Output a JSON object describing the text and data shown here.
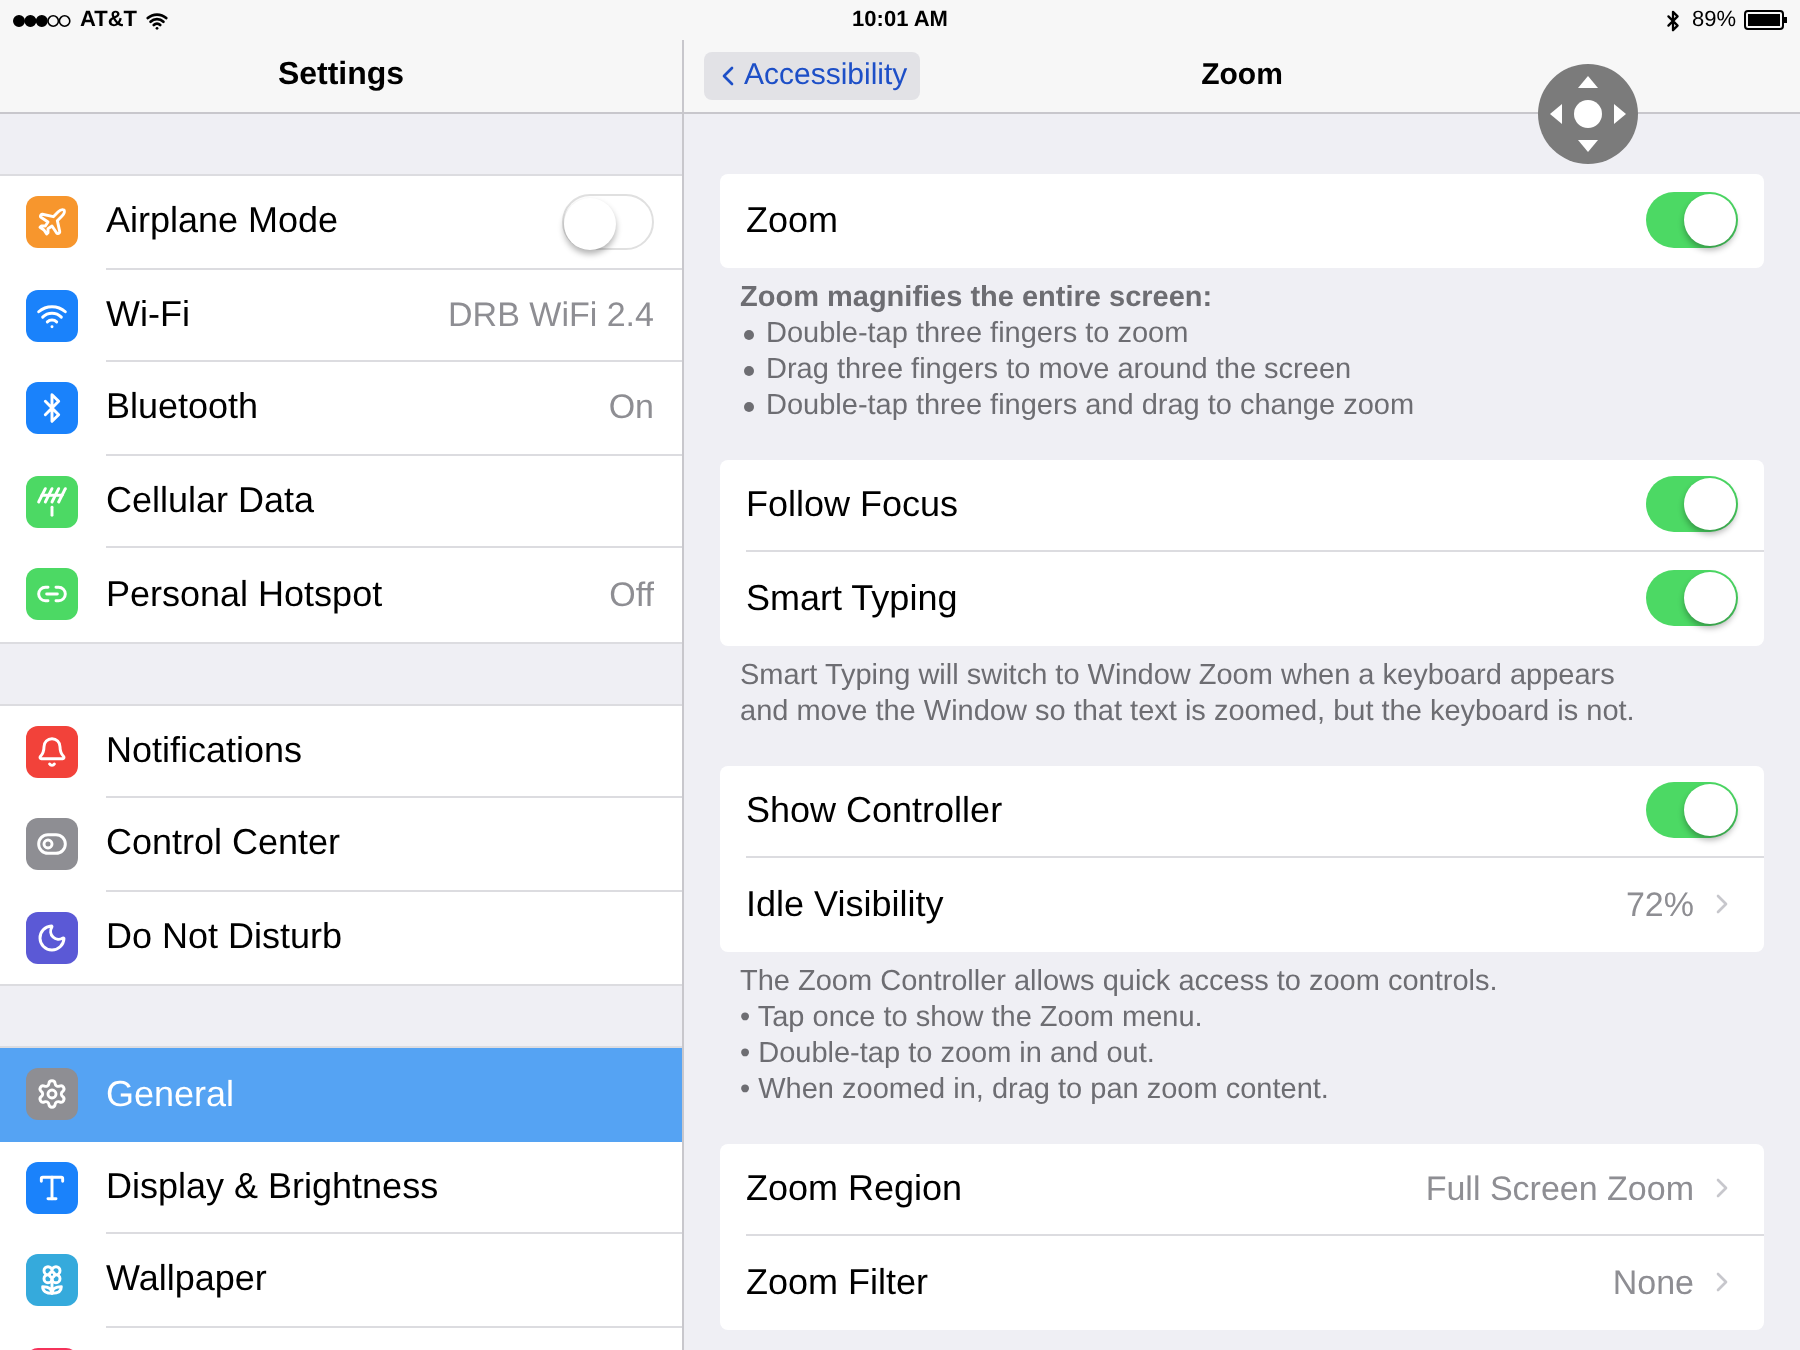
{
  "status_bar": {
    "carrier": "AT&T",
    "time": "10:01 AM",
    "battery": "89%"
  },
  "sidebar": {
    "title": "Settings",
    "groups": [
      {
        "items": [
          {
            "label": "Airplane Mode",
            "kind": "toggle",
            "on": false,
            "selected": false,
            "color": "#f7962d"
          },
          {
            "label": "Wi-Fi",
            "kind": "value",
            "value": "DRB WiFi 2.4",
            "selected": false,
            "color": "#1a82fb"
          },
          {
            "label": "Bluetooth",
            "kind": "value",
            "value": "On",
            "selected": false,
            "color": "#1a82fb"
          },
          {
            "label": "Cellular Data",
            "kind": "plain",
            "selected": false,
            "color": "#4cd964"
          },
          {
            "label": "Personal Hotspot",
            "kind": "value",
            "value": "Off",
            "selected": false,
            "color": "#4cd964"
          }
        ]
      },
      {
        "items": [
          {
            "label": "Notifications",
            "kind": "plain",
            "selected": false,
            "color": "#f2423a"
          },
          {
            "label": "Control Center",
            "kind": "plain",
            "selected": false,
            "color": "#8e8e93"
          },
          {
            "label": "Do Not Disturb",
            "kind": "plain",
            "selected": false,
            "color": "#5b59d6"
          }
        ]
      },
      {
        "items": [
          {
            "label": "General",
            "kind": "plain",
            "selected": true,
            "color": "#8e8e93"
          },
          {
            "label": "Display & Brightness",
            "kind": "plain",
            "selected": false,
            "color": "#1a82fb"
          },
          {
            "label": "Wallpaper",
            "kind": "plain",
            "selected": false,
            "color": "#35aadc"
          },
          {
            "kind": "cut",
            "selected": false,
            "color": "#f5325a"
          }
        ]
      }
    ]
  },
  "detail": {
    "back": "Accessibility",
    "title": "Zoom",
    "sections": [
      {
        "rows": [
          {
            "label": "Zoom",
            "kind": "toggle",
            "on": true
          }
        ],
        "footer": {
          "heading": "Zoom magnifies the entire screen:",
          "bullets": [
            "Double-tap three fingers to zoom",
            "Drag three fingers to move around the screen",
            "Double-tap three fingers and drag to change zoom"
          ]
        }
      },
      {
        "rows": [
          {
            "label": "Follow Focus",
            "kind": "toggle",
            "on": true
          },
          {
            "label": "Smart Typing",
            "kind": "toggle",
            "on": true
          }
        ],
        "footer": {
          "lines": [
            "Smart Typing will switch to Window Zoom when a keyboard appears",
            "and move the Window so that text is zoomed, but the keyboard is not."
          ]
        }
      },
      {
        "rows": [
          {
            "label": "Show Controller",
            "kind": "toggle",
            "on": true
          },
          {
            "label": "Idle Visibility",
            "kind": "value",
            "value": "72%"
          }
        ],
        "footer": {
          "lines": [
            "The Zoom Controller allows quick access to zoom controls.",
            "• Tap once to show the Zoom menu.",
            "• Double-tap to zoom in and out.",
            "• When zoomed in, drag to pan zoom content."
          ]
        }
      },
      {
        "rows": [
          {
            "label": "Zoom Region",
            "kind": "value",
            "value": "Full Screen Zoom"
          },
          {
            "label": "Zoom Filter",
            "kind": "value",
            "value": "None"
          }
        ]
      }
    ]
  }
}
